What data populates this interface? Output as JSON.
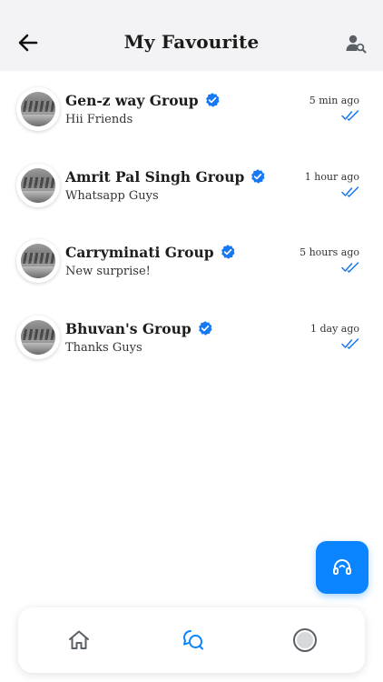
{
  "header": {
    "title": "My Favourite"
  },
  "chats": [
    {
      "name": "Gen-z way Group",
      "message": "Hii Friends",
      "time": "5 min ago"
    },
    {
      "name": "Amrit Pal Singh Group",
      "message": "Whatsapp Guys",
      "time": "1 hour ago"
    },
    {
      "name": "Carryminati Group",
      "message": "New surprise!",
      "time": "5 hours ago"
    },
    {
      "name": "Bhuvan's Group",
      "message": "Thanks Guys",
      "time": "1 day ago"
    }
  ],
  "icons": {
    "back": "arrow-left-icon",
    "user_search": "user-search-icon",
    "verified": "verified-badge-icon",
    "read_receipt": "double-check-icon",
    "support": "headset-icon",
    "home": "home-icon",
    "chats": "chat-bubbles-icon",
    "profile": "profile-circle-icon"
  },
  "colors": {
    "accent": "#0a84ff",
    "header_bg": "#f3f3f5",
    "verified": "#1877f2"
  },
  "bottom_nav": {
    "active": "chats"
  }
}
